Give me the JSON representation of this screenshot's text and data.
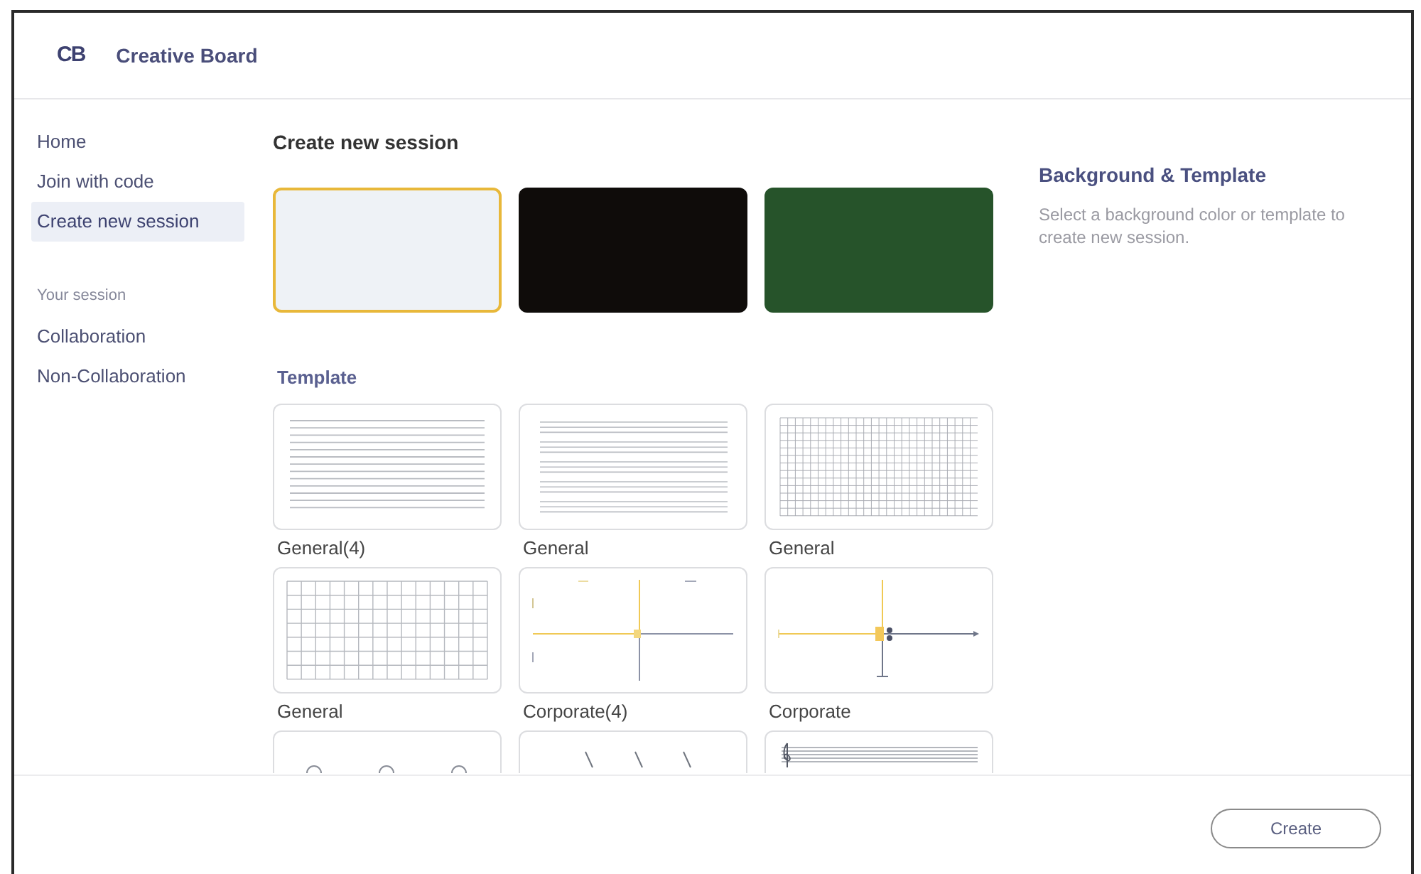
{
  "header": {
    "logo": "CB",
    "title": "Creative Board"
  },
  "sidebar": {
    "items": [
      {
        "label": "Home",
        "selected": false
      },
      {
        "label": "Join with code",
        "selected": false
      },
      {
        "label": "Create new session",
        "selected": true
      }
    ],
    "section": {
      "title": "Your session",
      "items": [
        {
          "label": "Collaboration",
          "selected": false
        },
        {
          "label": "Non-Collaboration",
          "selected": false
        }
      ]
    }
  },
  "main": {
    "title": "Create new session",
    "backgrounds": [
      {
        "color": "#eef2f6",
        "selected": true
      },
      {
        "color": "#0f0c0a",
        "selected": false
      },
      {
        "color": "#26532a",
        "selected": false
      }
    ],
    "template_title": "Template",
    "templates": [
      {
        "kind": "ruled",
        "label": "General(4)",
        "selected": false
      },
      {
        "kind": "ruled-grouped",
        "label": "General",
        "selected": false
      },
      {
        "kind": "fine-grid",
        "label": "General",
        "selected": false
      },
      {
        "kind": "grid",
        "label": "General",
        "selected": false
      },
      {
        "kind": "axes",
        "label": "Corporate(4)",
        "selected": false
      },
      {
        "kind": "axes-marker",
        "label": "Corporate",
        "selected": false
      },
      {
        "kind": "circles",
        "selected": false
      },
      {
        "kind": "diagonal",
        "selected": false
      },
      {
        "kind": "staff",
        "selected": false
      }
    ]
  },
  "info": {
    "title": "Background & Template",
    "description": "Select a background color or template to create new session."
  },
  "footer": {
    "button": "Create"
  }
}
